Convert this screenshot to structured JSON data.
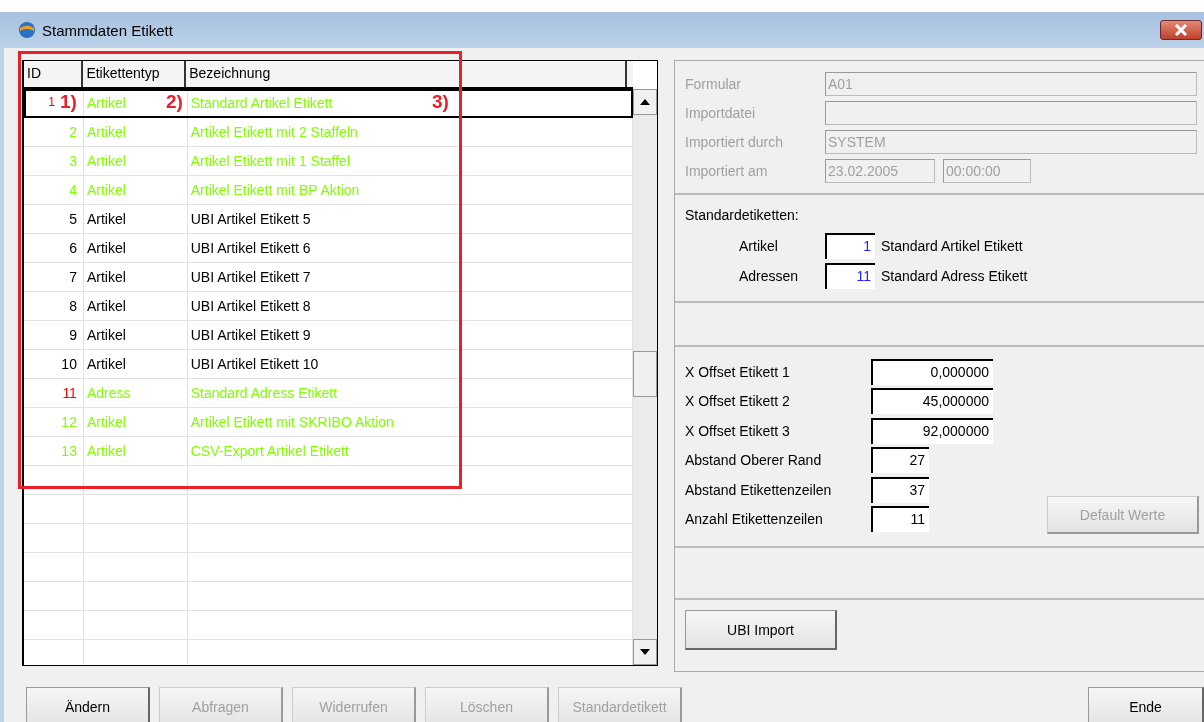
{
  "window": {
    "title": "Stammdaten Etikett"
  },
  "table": {
    "columns": [
      "ID",
      "Etikettentyp",
      "Bezeichnung"
    ],
    "rows": [
      {
        "id": "1",
        "type": "Artikel",
        "name": "Standard Artikel Etikett",
        "color": "#80ff00",
        "standard": true,
        "selected": true
      },
      {
        "id": "2",
        "type": "Artikel",
        "name": "Artikel Etikett mit 2 Staffeln",
        "color": "#80ff00",
        "standard": false,
        "selected": false
      },
      {
        "id": "3",
        "type": "Artikel",
        "name": "Artikel Etikett mit 1 Staffel",
        "color": "#80ff00",
        "standard": false,
        "selected": false
      },
      {
        "id": "4",
        "type": "Artikel",
        "name": "Artikel Etikett mit BP Aktion",
        "color": "#80ff00",
        "standard": false,
        "selected": false
      },
      {
        "id": "5",
        "type": "Artikel",
        "name": "UBI Artikel Etikett 5",
        "color": "#000000",
        "standard": false,
        "selected": false
      },
      {
        "id": "6",
        "type": "Artikel",
        "name": "UBI Artikel Etikett 6",
        "color": "#000000",
        "standard": false,
        "selected": false
      },
      {
        "id": "7",
        "type": "Artikel",
        "name": "UBI Artikel Etikett 7",
        "color": "#000000",
        "standard": false,
        "selected": false
      },
      {
        "id": "8",
        "type": "Artikel",
        "name": "UBI Artikel Etikett 8",
        "color": "#000000",
        "standard": false,
        "selected": false
      },
      {
        "id": "9",
        "type": "Artikel",
        "name": "UBI Artikel Etikett 9",
        "color": "#000000",
        "standard": false,
        "selected": false
      },
      {
        "id": "10",
        "type": "Artikel",
        "name": "UBI Artikel Etikett 10",
        "color": "#000000",
        "standard": false,
        "selected": false
      },
      {
        "id": "11",
        "type": "Adress",
        "name": "Standard Adress Etikett",
        "color": "#80ff00",
        "standard": true,
        "selected": false
      },
      {
        "id": "12",
        "type": "Artikel",
        "name": "Artikel Etikett mit SKRIBO Aktion",
        "color": "#80ff00",
        "standard": false,
        "selected": false
      },
      {
        "id": "13",
        "type": "Artikel",
        "name": "CSV-Export Artikel Etikett",
        "color": "#80ff00",
        "standard": false,
        "selected": false
      }
    ]
  },
  "annotations": [
    "1)",
    "2)",
    "3)"
  ],
  "import_info": [
    {
      "label": "Formular",
      "values": [
        "A01"
      ]
    },
    {
      "label": "Importdatei"
    },
    {
      "label": "Importiert durch",
      "values": [
        "SYSTEM"
      ]
    },
    {
      "label": "Importiert am",
      "values": [
        "23.02.2005",
        "00:00:00"
      ]
    }
  ],
  "standard_labels": {
    "title": "Standardetiketten:",
    "items": [
      {
        "label": "Artikel",
        "id": "1",
        "name": "Standard Artikel Etikett"
      },
      {
        "label": "Adressen",
        "id": "11",
        "name": "Standard Adress Etikett"
      }
    ]
  },
  "offsets": [
    {
      "label": "X Offset Etikett 1",
      "value": "0,000000",
      "kind": "wide"
    },
    {
      "label": "X Offset Etikett 2",
      "value": "45,000000",
      "kind": "wide"
    },
    {
      "label": "X Offset Etikett 3",
      "value": "92,000000",
      "kind": "wide"
    },
    {
      "label": "Abstand Oberer Rand",
      "value": "27",
      "kind": "narrow"
    },
    {
      "label": "Abstand Etikettenzeilen",
      "value": "37",
      "kind": "narrow"
    },
    {
      "label": "Anzahl Etikettenzeilen",
      "value": "11",
      "kind": "narrow"
    }
  ],
  "default_button": {
    "label": "Default Werte",
    "disabled": true
  },
  "import_button": {
    "label": "UBI Import",
    "disabled": false
  },
  "buttons": [
    {
      "label": "Ändern",
      "disabled": false
    },
    {
      "label": "Abfragen",
      "disabled": true
    },
    {
      "label": "Widerrufen",
      "disabled": true
    },
    {
      "label": "Löschen",
      "disabled": true
    },
    {
      "label": "Standardetikett",
      "disabled": true
    }
  ],
  "end_button": {
    "label": "Ende",
    "disabled": false
  }
}
